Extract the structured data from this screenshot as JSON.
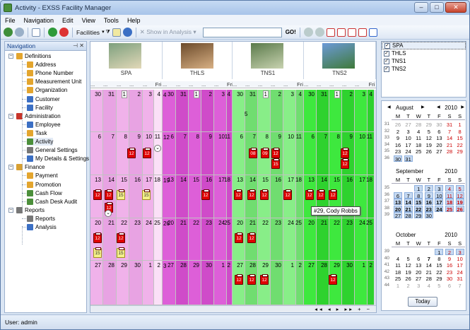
{
  "title": "Activity - EXSS Facility Manager",
  "menu": [
    "File",
    "Navigation",
    "Edit",
    "View",
    "Tools",
    "Help"
  ],
  "toolbar": {
    "facilities": "Facilities",
    "show_in_analysis": "Show in Analysis",
    "go": "GO!"
  },
  "nav": {
    "title": "Navigation",
    "items": [
      {
        "t": "Definitions",
        "lv": 0,
        "c": "#e3a52e"
      },
      {
        "t": "Address",
        "lv": 1,
        "c": "#e3a52e"
      },
      {
        "t": "Phone Number",
        "lv": 1,
        "c": "#e3a52e"
      },
      {
        "t": "Measurement Unit",
        "lv": 1,
        "c": "#e3a52e"
      },
      {
        "t": "Organization",
        "lv": 1,
        "c": "#e3a52e"
      },
      {
        "t": "Customer",
        "lv": 1,
        "c": "#3b6fc4"
      },
      {
        "t": "Facility",
        "lv": 1,
        "c": "#3b6fc4"
      },
      {
        "t": "Administration",
        "lv": 0,
        "c": "#c8352b"
      },
      {
        "t": "Employee",
        "lv": 1,
        "c": "#3b6fc4"
      },
      {
        "t": "Task",
        "lv": 1,
        "c": "#e3a52e"
      },
      {
        "t": "Activity",
        "lv": 1,
        "c": "#4b8f3b",
        "sel": true
      },
      {
        "t": "General Settings",
        "lv": 1,
        "c": "#777"
      },
      {
        "t": "My Details & Settings",
        "lv": 1,
        "c": "#3b6fc4"
      },
      {
        "t": "Finance",
        "lv": 0,
        "c": "#d8a032"
      },
      {
        "t": "Payment",
        "lv": 1,
        "c": "#e3a52e"
      },
      {
        "t": "Promotion",
        "lv": 1,
        "c": "#e3a52e"
      },
      {
        "t": "Cash Flow",
        "lv": 1,
        "c": "#4b8f3b"
      },
      {
        "t": "Cash Desk Audit",
        "lv": 1,
        "c": "#4b8f3b"
      },
      {
        "t": "Reports",
        "lv": 0,
        "c": "#777"
      },
      {
        "t": "Reports",
        "lv": 1,
        "c": "#777"
      },
      {
        "t": "Analysis",
        "lv": 1,
        "c": "#3b6fc4"
      }
    ]
  },
  "resources": [
    {
      "name": "SPA",
      "checked": true
    },
    {
      "name": "THLS",
      "checked": true
    },
    {
      "name": "TNS1",
      "checked": true
    },
    {
      "name": "TNS2",
      "checked": true
    }
  ],
  "colors": {
    "spa": "#f0b2ea",
    "thls": "#dd5fd8",
    "tns1": "#88ee88",
    "tns2": "#3ee83e"
  },
  "tooltip": "#29, Cody Robbs",
  "calendar": {
    "resources": [
      "SPA",
      "THLS",
      "TNS1",
      "TNS2"
    ],
    "dayhdr": [
      "...",
      "...",
      "...",
      "...",
      "...",
      "Fri",
      "..."
    ],
    "weeks": [
      [
        "30",
        "31",
        "1",
        "2",
        "3",
        "4"
      ],
      [
        "6",
        "7",
        "8",
        "9",
        "10",
        "11"
      ],
      [
        "13",
        "14",
        "15",
        "16",
        "17",
        "18"
      ],
      [
        "20",
        "21",
        "22",
        "23",
        "24",
        "25"
      ],
      [
        "27",
        "28",
        "29",
        "30",
        "1",
        "2"
      ]
    ],
    "sidenums": [
      [
        "4",
        "5"
      ],
      [
        "12"
      ],
      [
        "19"
      ],
      [
        "26"
      ],
      [
        "3"
      ]
    ],
    "event_labels": {
      "r": "12",
      "y": "15",
      "a": "08",
      "b": "09"
    }
  },
  "months": [
    {
      "name": "August",
      "year": "2010",
      "weeks": [
        [
          "31",
          "26",
          "27",
          "28",
          "29",
          "30",
          "31",
          "1"
        ],
        [
          "32",
          "2",
          "3",
          "4",
          "5",
          "6",
          "7",
          "8"
        ],
        [
          "33",
          "9",
          "10",
          "11",
          "12",
          "13",
          "14",
          "15"
        ],
        [
          "34",
          "16",
          "17",
          "18",
          "19",
          "20",
          "21",
          "22"
        ],
        [
          "35",
          "23",
          "24",
          "25",
          "26",
          "27",
          "28",
          "29"
        ],
        [
          "36",
          "30",
          "31",
          "",
          "",
          "",
          "",
          ""
        ]
      ]
    },
    {
      "name": "September",
      "year": "2010",
      "weeks": [
        [
          "35",
          "",
          "",
          "1",
          "2",
          "3",
          "4",
          "5"
        ],
        [
          "36",
          "6",
          "7",
          "8",
          "9",
          "10",
          "11",
          "12"
        ],
        [
          "37",
          "13",
          "14",
          "15",
          "16",
          "17",
          "18",
          "19"
        ],
        [
          "38",
          "20",
          "21",
          "22",
          "23",
          "24",
          "25",
          "26"
        ],
        [
          "39",
          "27",
          "28",
          "29",
          "30",
          "",
          "",
          ""
        ]
      ]
    },
    {
      "name": "October",
      "year": "2010",
      "weeks": [
        [
          "39",
          "",
          "",
          "",
          "",
          "1",
          "2",
          "3"
        ],
        [
          "40",
          "4",
          "5",
          "6",
          "7",
          "8",
          "9",
          "10"
        ],
        [
          "41",
          "11",
          "12",
          "13",
          "14",
          "15",
          "16",
          "17"
        ],
        [
          "42",
          "18",
          "19",
          "20",
          "21",
          "22",
          "23",
          "24"
        ],
        [
          "43",
          "25",
          "26",
          "27",
          "28",
          "29",
          "30",
          "31"
        ],
        [
          "44",
          "1",
          "2",
          "3",
          "4",
          "5",
          "6",
          "7"
        ]
      ]
    }
  ],
  "daynames": [
    "M",
    "T",
    "W",
    "T",
    "F",
    "S",
    "S"
  ],
  "today": "Today",
  "status": "User: admin"
}
